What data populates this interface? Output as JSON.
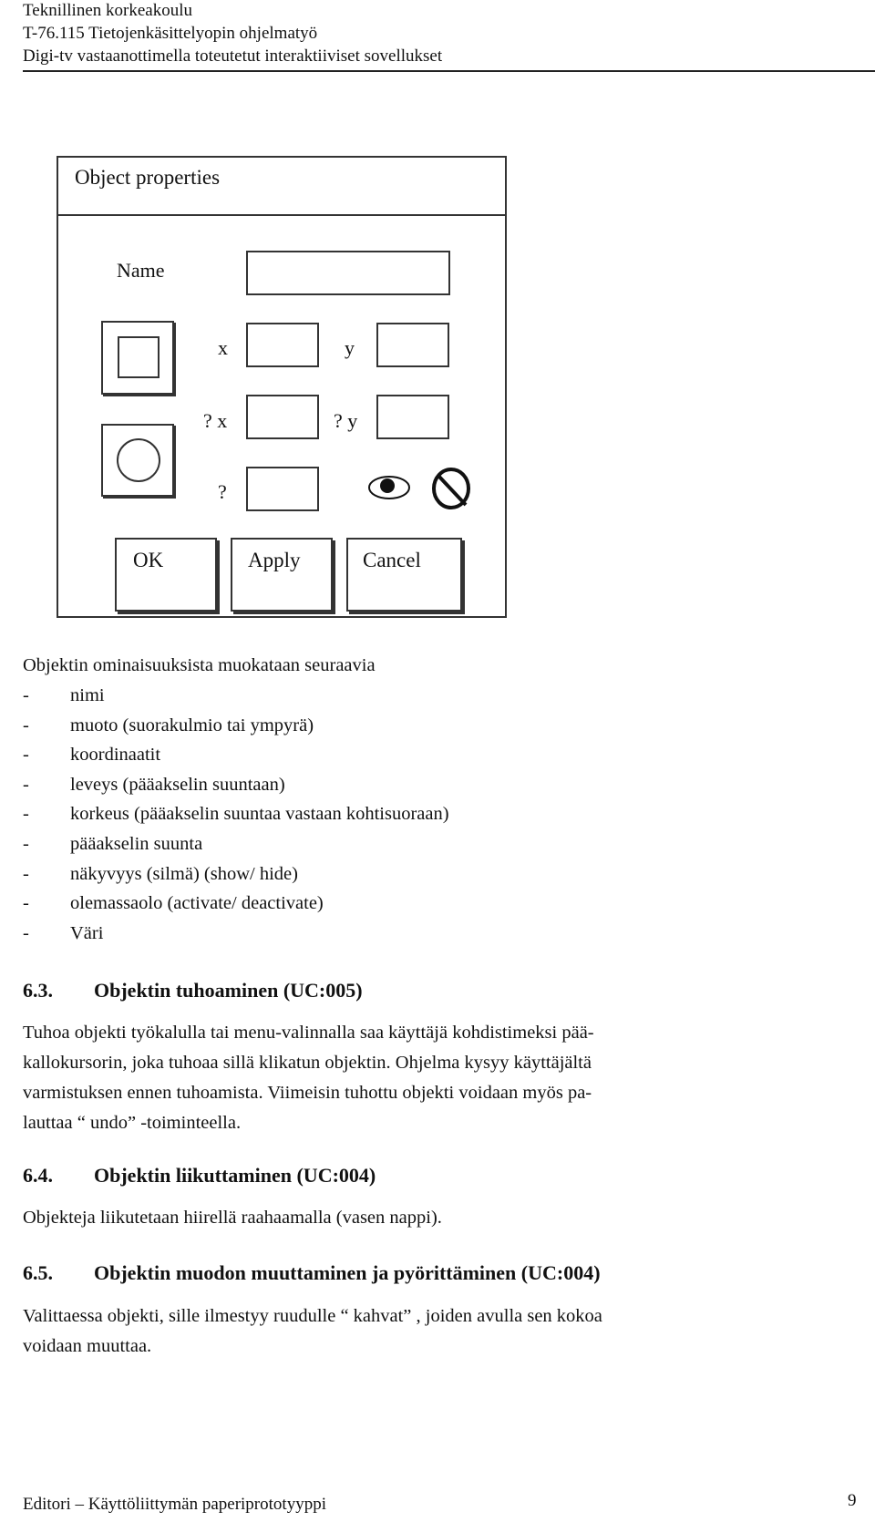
{
  "header": {
    "line1": "Teknillinen korkeakoulu",
    "line2": "T-76.115 Tietojenkäsittelyopin ohjelmatyö",
    "line3": "Digi-tv vastaanottimella toteutetut interaktiiviset sovellukset"
  },
  "dialog": {
    "title": "Object properties",
    "name_label": "Name",
    "name_value": "",
    "x_label": "x",
    "x_value": "",
    "y_label": "y",
    "y_value": "",
    "dx_label": "? x",
    "dx_value": "",
    "dy_label": "? y",
    "dy_value": "",
    "angle_label": "?",
    "angle_value": "",
    "shape_options": [
      "rectangle-icon",
      "circle-icon"
    ],
    "visibility_icon": "eye-icon",
    "deactivate_icon": "prohibited-icon",
    "buttons": {
      "ok": "OK",
      "apply": "Apply",
      "cancel": "Cancel"
    }
  },
  "properties": {
    "intro": "Objektin ominaisuuksista muokataan seuraavia",
    "bullet": "-",
    "items": [
      "nimi",
      "muoto (suorakulmio tai ympyrä)",
      "koordinaatit",
      "leveys (pääakselin suuntaan)",
      "korkeus (pääakselin suuntaa vastaan kohtisuoraan)",
      "pääakselin suunta",
      "näkyvyys (silmä) (show/ hide)",
      "olemassaolo (activate/ deactivate)",
      "Väri"
    ]
  },
  "sections": [
    {
      "number": "6.3.",
      "title": "Objektin tuhoaminen (UC:005)",
      "lines": [
        "Tuhoa objekti työkalulla tai menu-valinnalla saa käyttäjä kohdistimeksi pää-",
        "kallokursorin, joka tuhoaa sillä klikatun objektin. Ohjelma kysyy käyttäjältä",
        "varmistuksen ennen tuhoamista. Viimeisin tuhottu objekti voidaan myös pa-",
        "lauttaa “ undo” -toiminteella."
      ]
    },
    {
      "number": "6.4.",
      "title": "Objektin liikuttaminen (UC:004)",
      "lines": [
        "Objekteja liikutetaan hiirellä raahaamalla (vasen nappi)."
      ]
    },
    {
      "number": "6.5.",
      "title": "Objektin muodon muuttaminen ja pyörittäminen (UC:004)",
      "lines": [
        "Valittaessa objekti, sille ilmestyy ruudulle “ kahvat” , joiden avulla sen kokoa",
        "voidaan muuttaa."
      ]
    }
  ],
  "footer": {
    "title": "Editori – Käyttöliittymän paperiprototyyppi",
    "page": "9"
  }
}
